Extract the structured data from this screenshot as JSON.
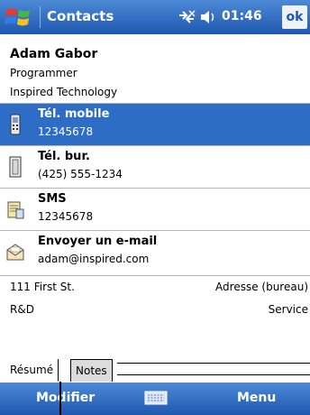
{
  "titlebar": {
    "app_title": "Contacts",
    "clock": "01:46",
    "ok_label": "ok"
  },
  "contact": {
    "name": "Adam Gabor",
    "job_title": "Programmer",
    "company": "Inspired Technology"
  },
  "rows": [
    {
      "label": "Tél. mobile",
      "value": "12345678",
      "icon": "mobile-phone-icon",
      "selected": true
    },
    {
      "label": "Tél. bur.",
      "value": "(425) 555-1234",
      "icon": "desk-phone-icon",
      "selected": false
    },
    {
      "label": "SMS",
      "value": "12345678",
      "icon": "sms-icon",
      "selected": false
    },
    {
      "label": "Envoyer un e-mail",
      "value": "adam@inspired.com",
      "icon": "email-icon",
      "selected": false
    }
  ],
  "address": {
    "value": "111 First St.",
    "label": "Adresse (bureau)"
  },
  "department": {
    "value": "R&D",
    "label": "Service"
  },
  "tabs": [
    {
      "label": "Résumé",
      "active": true
    },
    {
      "label": "Notes",
      "active": false
    }
  ],
  "menubar": {
    "left": "Modifier",
    "right": "Menu"
  },
  "colors": {
    "titlebar": "#2e6dc6",
    "selection": "#2e6dc6"
  }
}
